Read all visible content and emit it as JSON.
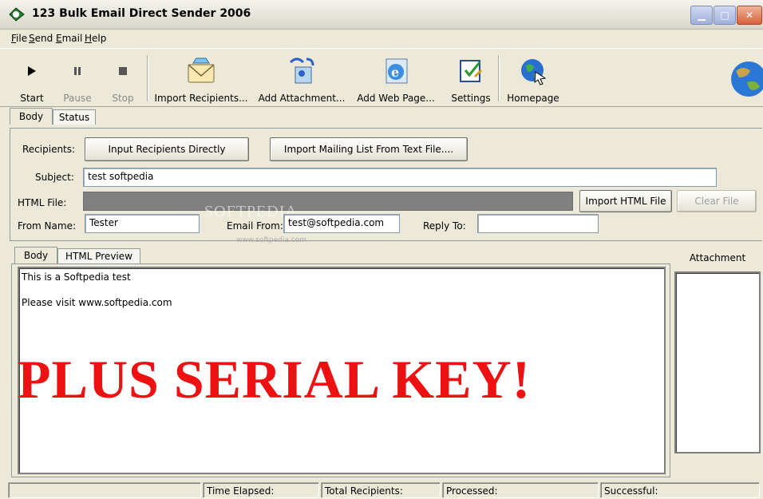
{
  "window": {
    "title": "123 Bulk Email Direct Sender 2006"
  },
  "menu": [
    "File",
    "Send",
    "Email",
    "Help"
  ],
  "toolbar": {
    "start": "Start",
    "pause": "Pause",
    "stop": "Stop",
    "import_recipients": "Import Recipients...",
    "add_attachment": "Add Attachment...",
    "add_web_page": "Add Web Page...",
    "settings": "Settings",
    "homepage": "Homepage"
  },
  "tabs": {
    "body": "Body",
    "status": "Status"
  },
  "form": {
    "recipients_label": "Recipients:",
    "input_recipients_button": "Input Recipients Directly",
    "import_mailing_list_button": "Import Mailing List From Text File....",
    "subject_label": "Subject:",
    "subject_value": "test softpedia",
    "html_file_label": "HTML File:",
    "import_html_button": "Import HTML File",
    "clear_file_button": "Clear File",
    "from_name_label": "From Name:",
    "from_name_value": "Tester",
    "email_from_label": "Email From:",
    "email_from_value": "test@softpedia.com",
    "reply_to_label": "Reply To:",
    "reply_to_value": ""
  },
  "editor_tabs": {
    "body": "Body",
    "html_preview": "HTML Preview"
  },
  "attachment": {
    "header": "Attachment"
  },
  "body_text": {
    "line1": "This is a Softpedia test",
    "line2": "Please visit www.softpedia.com"
  },
  "overlay": "PLUS SERIAL KEY!",
  "watermark": {
    "main": "SOFTPEDIA",
    "sub": "www.softpedia.com"
  },
  "statusbar": {
    "time_elapsed": "Time Elapsed:",
    "total_recipients": "Total Recipients:",
    "processed": "Processed:",
    "successful": "Successful:"
  },
  "colors": {
    "overlay": "#ee1111",
    "window_bg": "#ece9d8"
  },
  "icons": {
    "start": "play-icon",
    "pause": "pause-icon",
    "stop": "stop-icon",
    "import_recipients": "envelope-icon",
    "add_attachment": "attachment-icon",
    "add_web_page": "ie-globe-icon",
    "settings": "settings-check-icon",
    "homepage": "homepage-globe-icon",
    "brand": "earth-globe-icon"
  }
}
